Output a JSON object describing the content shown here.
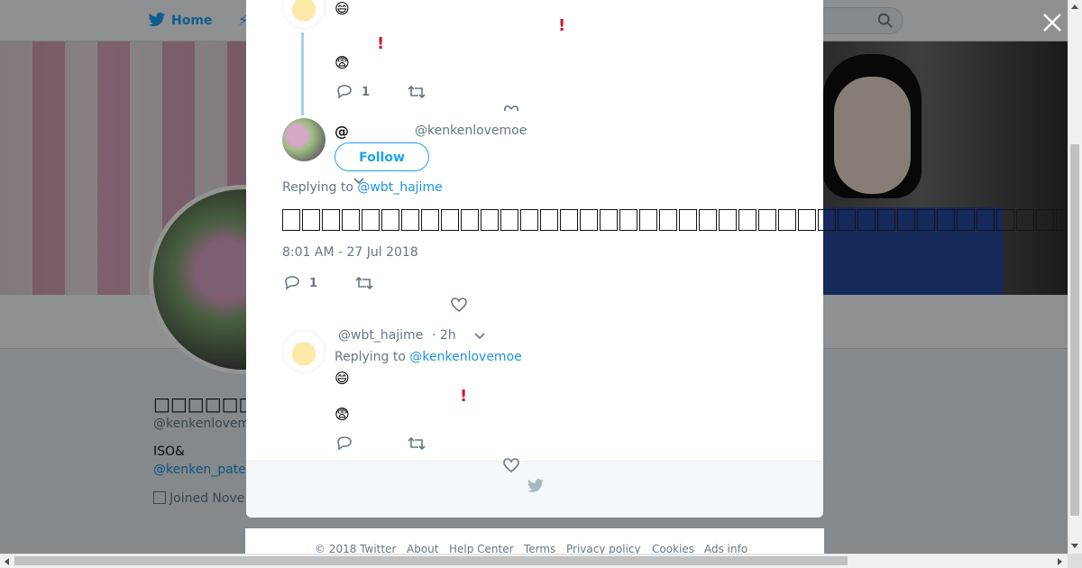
{
  "topnav": {
    "home_label": "Home",
    "login_label": "in"
  },
  "profile": {
    "name": "□□□□□□@□",
    "handle": "@kenkenlovem",
    "bio": "ISO&",
    "link": "@kenken_pate",
    "joined": "Joined Nove"
  },
  "modal": {
    "prev_tweet": {
      "emoji_1": "😄",
      "emoji_2": "😨",
      "exclaim": "!",
      "reply_count": "1"
    },
    "main_tweet": {
      "name_prefix": "@",
      "handle": "@kenkenlovemoe",
      "follow_label": "Follow",
      "replying_prefix": "Replying to",
      "replying_to": "@wbt_hajime",
      "timestamp": "8:01 AM - 27 Jul 2018",
      "reply_count": "1"
    },
    "reply_tweet": {
      "handle": "@wbt_hajime",
      "time": "· 2h",
      "replying_prefix": "Replying to",
      "replying_to": "@kenkenlovemoe",
      "emoji_1": "😄",
      "emoji_2": "😨",
      "exclaim": "!"
    }
  },
  "footer": {
    "copyright": "© 2018 Twitter",
    "about": "About",
    "help": "Help Center",
    "terms": "Terms",
    "privacy": "Privacy policy",
    "cookies": "Cookies",
    "ads": "Ads info"
  },
  "colors": {
    "accent": "#1da1f2",
    "link": "#1b95e0",
    "exclaim": "#cf1a2f",
    "thread_line": "#a5d0f0"
  },
  "icons": [
    "twitter-bird-icon",
    "search-icon",
    "close-icon",
    "reply-icon",
    "retweet-icon",
    "like-icon",
    "chevron-down-icon",
    "calendar-icon"
  ]
}
